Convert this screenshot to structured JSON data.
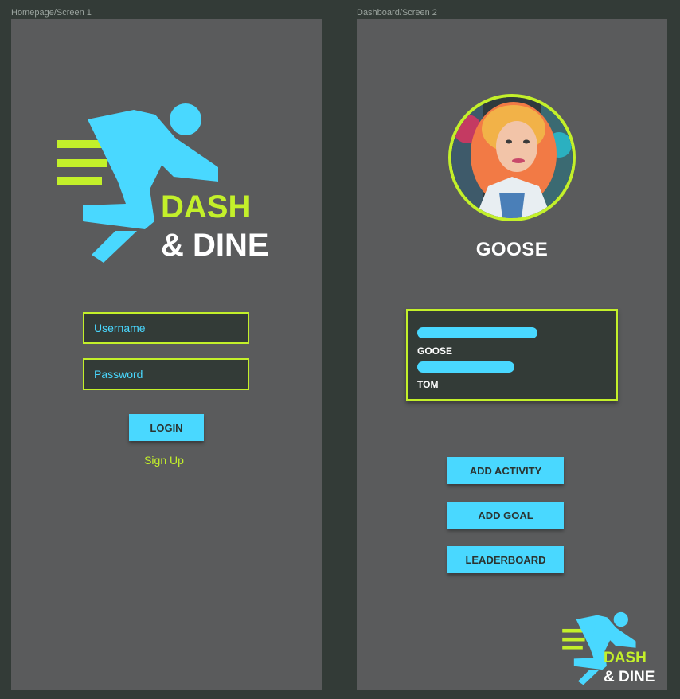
{
  "frames": {
    "homepage_label": "Homepage/Screen 1",
    "dashboard_label": "Dashboard/Screen 2"
  },
  "logo": {
    "word1": "DASH",
    "word2": "& DINE"
  },
  "login": {
    "username_placeholder": "Username",
    "password_placeholder": "Password",
    "login_label": "LOGIN",
    "signup_label": "Sign Up"
  },
  "dashboard": {
    "user_name": "GOOSE",
    "leaderboard_rows": [
      {
        "name": "GOOSE",
        "progress": 0.62
      },
      {
        "name": "TOM",
        "progress": 0.5
      }
    ],
    "buttons": {
      "add_activity": "ADD ACTIVITY",
      "add_goal": "ADD GOAL",
      "leaderboard": "LEADERBOARD"
    }
  },
  "colors": {
    "background": "#333b37",
    "frame": "#5a5b5c",
    "accent_green": "#c3f02a",
    "accent_blue": "#49d8ff",
    "text_white": "#ffffff"
  },
  "icons": {
    "logo": "running-person-icon",
    "avatar": "profile-photo"
  }
}
